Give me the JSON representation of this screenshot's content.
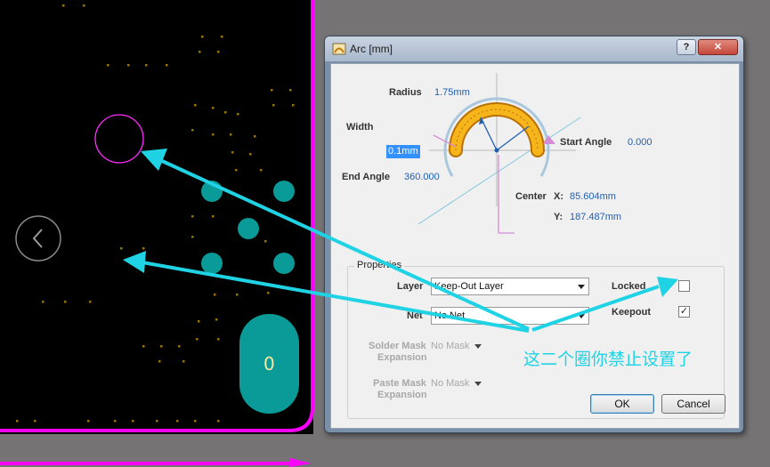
{
  "canvas": {
    "pad_label": "0",
    "colors": {
      "board_outline": "#ff00ff",
      "pad": "#0a9a98",
      "via_dot": "#8a6a00",
      "arc_keepout": "#ff2dff"
    }
  },
  "dialog": {
    "title": "Arc [mm]",
    "help_label": "?",
    "close_label": "✕",
    "radius_label": "Radius",
    "radius_value": "1.75mm",
    "width_label": "Width",
    "width_value": "0.1mm",
    "start_angle_label": "Start Angle",
    "start_angle_value": "0.000",
    "end_angle_label": "End Angle",
    "end_angle_value": "360.000",
    "center_label": "Center",
    "center_x_label": "X:",
    "center_x_value": "85.604mm",
    "center_y_label": "Y:",
    "center_y_value": "187.487mm",
    "properties": {
      "group_title": "Properties",
      "layer_label": "Layer",
      "layer_value": "Keep-Out Layer",
      "net_label": "Net",
      "net_value": "No Net",
      "locked_label": "Locked",
      "locked_checked": false,
      "keepout_label": "Keepout",
      "keepout_checked": true,
      "keepout_mark": "✓",
      "solder_mask_label_1": "Solder Mask",
      "solder_mask_label_2": "Expansion",
      "solder_mask_value": "No Mask",
      "paste_mask_label_1": "Paste Mask",
      "paste_mask_label_2": "Expansion",
      "paste_mask_value": "No Mask"
    },
    "ok_label": "OK",
    "cancel_label": "Cancel"
  },
  "annotation": {
    "text": "这二个圈你禁止设置了",
    "color": "#20d3e4"
  },
  "nav": {
    "back_icon": "chevron-left-icon"
  }
}
